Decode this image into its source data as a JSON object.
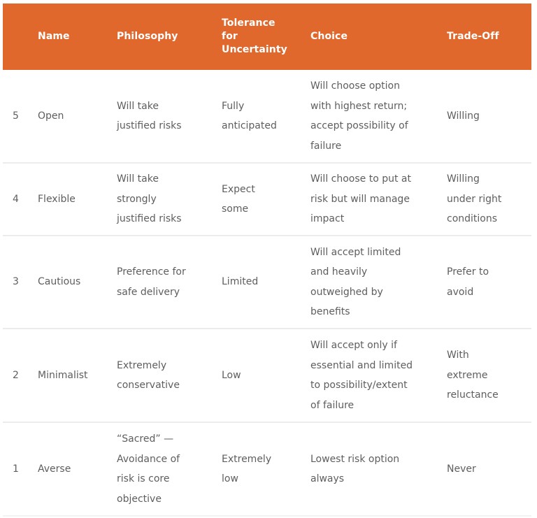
{
  "table": {
    "header_color": "#e0682c",
    "headers": {
      "level": "",
      "name": "Name",
      "philosophy": "Philosophy",
      "tolerance": [
        "Tolerance",
        "for",
        "Uncertainty"
      ],
      "choice": "Choice",
      "tradeoff": "Trade-Off"
    },
    "rows": [
      {
        "level": "5",
        "name": "Open",
        "philosophy": [
          "Will take",
          "justified risks"
        ],
        "tolerance": [
          "Fully",
          "anticipated"
        ],
        "choice": [
          "Will choose option",
          "with highest return;",
          "accept possibility of",
          "failure"
        ],
        "tradeoff": [
          "Willing"
        ]
      },
      {
        "level": "4",
        "name": "Flexible",
        "philosophy": [
          "Will take",
          "strongly",
          "justified risks"
        ],
        "tolerance": [
          "Expect",
          "some"
        ],
        "choice": [
          "Will choose to put at",
          "risk but will manage",
          "impact"
        ],
        "tradeoff": [
          "Willing",
          "under right",
          "conditions"
        ]
      },
      {
        "level": "3",
        "name": "Cautious",
        "philosophy": [
          "Preference for",
          "safe delivery"
        ],
        "tolerance": [
          "Limited"
        ],
        "choice": [
          "Will accept limited",
          "and heavily",
          "outweighed by",
          "benefits"
        ],
        "tradeoff": [
          "Prefer to",
          "avoid"
        ]
      },
      {
        "level": "2",
        "name": "Minimalist",
        "philosophy": [
          "Extremely",
          "conservative"
        ],
        "tolerance": [
          "Low"
        ],
        "choice": [
          "Will accept only if",
          "essential and limited",
          "to possibility/extent",
          "of failure"
        ],
        "tradeoff": [
          "With",
          "extreme",
          "reluctance"
        ]
      },
      {
        "level": "1",
        "name": "Averse",
        "philosophy": [
          "“Sacred” —",
          "Avoidance of",
          "risk is core",
          "objective"
        ],
        "tolerance": [
          "Extremely",
          "low"
        ],
        "choice": [
          "Lowest risk option",
          "always"
        ],
        "tradeoff": [
          "Never"
        ]
      }
    ]
  }
}
